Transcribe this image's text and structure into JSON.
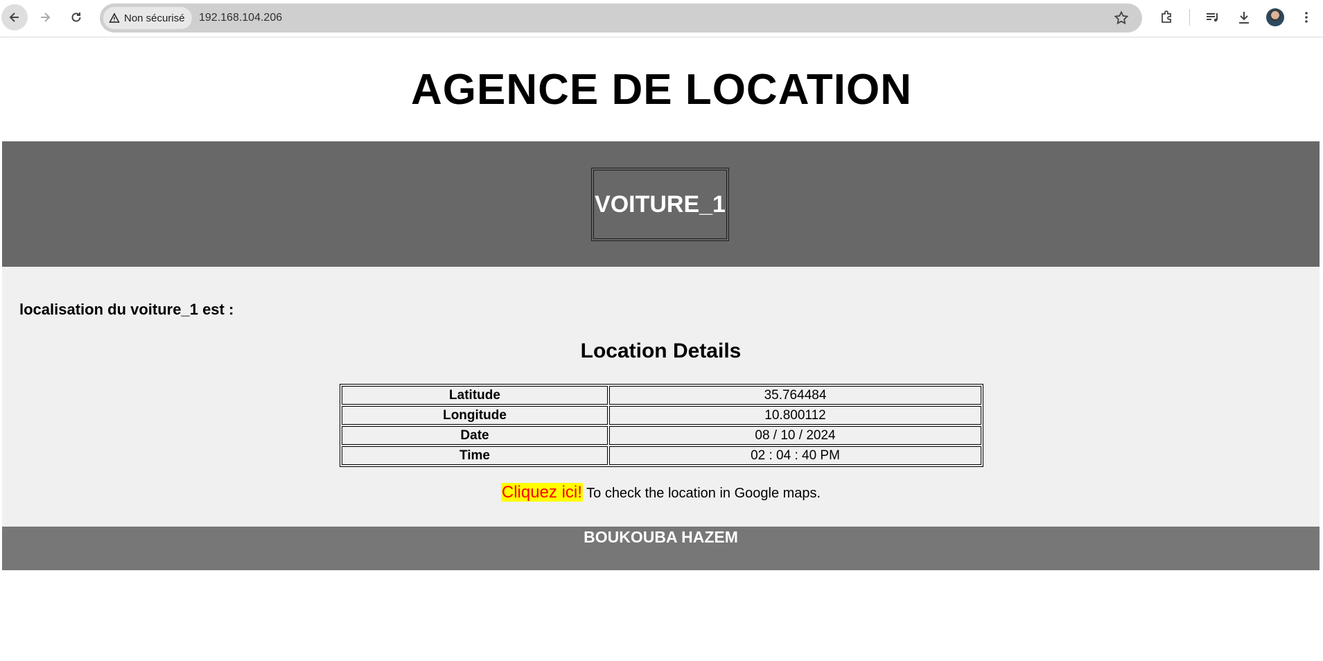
{
  "browser": {
    "security_label": "Non sécurisé",
    "url": "192.168.104.206"
  },
  "page": {
    "title": "AGENCE DE LOCATION",
    "car_name": "VOITURE_1",
    "location_label": "localisation du voiture_1 est :",
    "details_title": "Location Details",
    "rows": [
      {
        "label": "Latitude",
        "value": "35.764484"
      },
      {
        "label": "Longitude",
        "value": "10.800112"
      },
      {
        "label": "Date",
        "value": "08 / 10 / 2024"
      },
      {
        "label": "Time",
        "value": "02 : 04 : 40 PM"
      }
    ],
    "link_text": "Cliquez ici!",
    "link_suffix": " To check the location in Google maps.",
    "footer": "BOUKOUBA HAZEM"
  },
  "colors": {
    "banner": "#686868",
    "content_bg": "#f0f0f0",
    "footer": "#777777",
    "link_highlight": "#ffff00",
    "link_text": "#ff0000"
  }
}
